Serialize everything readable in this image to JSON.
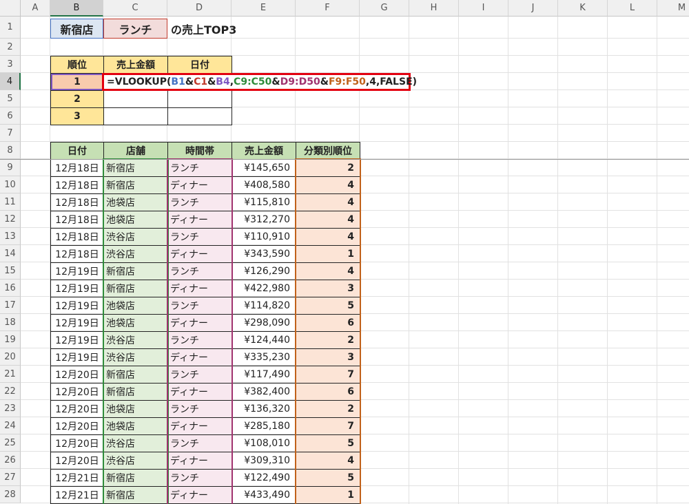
{
  "columns": [
    "A",
    "B",
    "C",
    "D",
    "E",
    "F",
    "G",
    "H",
    "I",
    "J",
    "K",
    "L",
    "M"
  ],
  "rows": [
    "1",
    "2",
    "3",
    "4",
    "5",
    "6",
    "7",
    "8",
    "9",
    "10",
    "11",
    "12",
    "13",
    "14",
    "15",
    "16",
    "17",
    "18",
    "19",
    "20",
    "21",
    "22",
    "23",
    "24",
    "25",
    "26",
    "27",
    "28"
  ],
  "title": {
    "store": "新宿店",
    "timeslot": "ランチ",
    "suffix": "の売上TOP3"
  },
  "top3": {
    "headers": [
      "順位",
      "売上金額",
      "日付"
    ],
    "ranks": [
      "1",
      "2",
      "3"
    ]
  },
  "formula": [
    {
      "t": "=VLOOKUP(",
      "c": "#222222"
    },
    {
      "t": "B1",
      "c": "#4472c4"
    },
    {
      "t": "&",
      "c": "#222222"
    },
    {
      "t": "C1",
      "c": "#c0392b"
    },
    {
      "t": "&",
      "c": "#222222"
    },
    {
      "t": "B4",
      "c": "#7e57c2"
    },
    {
      "t": ",",
      "c": "#222222"
    },
    {
      "t": "C9:C50",
      "c": "#2e8b3a"
    },
    {
      "t": "&",
      "c": "#222222"
    },
    {
      "t": "D9:D50",
      "c": "#a0336f"
    },
    {
      "t": "&",
      "c": "#222222"
    },
    {
      "t": "F9:F50",
      "c": "#c0611a"
    },
    {
      "t": ",4,FALSE)",
      "c": "#222222"
    }
  ],
  "sales": {
    "headers": [
      "日付",
      "店舗",
      "時間帯",
      "売上金額",
      "分類別順位"
    ],
    "rows": [
      [
        "12月18日",
        "新宿店",
        "ランチ",
        "¥145,650",
        "2"
      ],
      [
        "12月18日",
        "新宿店",
        "ディナー",
        "¥408,580",
        "4"
      ],
      [
        "12月18日",
        "池袋店",
        "ランチ",
        "¥115,810",
        "4"
      ],
      [
        "12月18日",
        "池袋店",
        "ディナー",
        "¥312,270",
        "4"
      ],
      [
        "12月18日",
        "渋谷店",
        "ランチ",
        "¥110,910",
        "4"
      ],
      [
        "12月18日",
        "渋谷店",
        "ディナー",
        "¥343,590",
        "1"
      ],
      [
        "12月19日",
        "新宿店",
        "ランチ",
        "¥126,290",
        "4"
      ],
      [
        "12月19日",
        "新宿店",
        "ディナー",
        "¥422,980",
        "3"
      ],
      [
        "12月19日",
        "池袋店",
        "ランチ",
        "¥114,820",
        "5"
      ],
      [
        "12月19日",
        "池袋店",
        "ディナー",
        "¥298,090",
        "6"
      ],
      [
        "12月19日",
        "渋谷店",
        "ランチ",
        "¥124,440",
        "2"
      ],
      [
        "12月19日",
        "渋谷店",
        "ディナー",
        "¥335,230",
        "3"
      ],
      [
        "12月20日",
        "新宿店",
        "ランチ",
        "¥117,490",
        "7"
      ],
      [
        "12月20日",
        "新宿店",
        "ディナー",
        "¥382,400",
        "6"
      ],
      [
        "12月20日",
        "池袋店",
        "ランチ",
        "¥136,320",
        "2"
      ],
      [
        "12月20日",
        "池袋店",
        "ディナー",
        "¥285,180",
        "7"
      ],
      [
        "12月20日",
        "渋谷店",
        "ランチ",
        "¥108,010",
        "5"
      ],
      [
        "12月20日",
        "渋谷店",
        "ディナー",
        "¥309,310",
        "4"
      ],
      [
        "12月21日",
        "新宿店",
        "ランチ",
        "¥122,490",
        "5"
      ],
      [
        "12月21日",
        "新宿店",
        "ディナー",
        "¥433,490",
        "1"
      ]
    ]
  },
  "colors": {
    "header_green": "#c6e0b4",
    "header_yellow": "#ffe699",
    "store_fill": "#e2efda",
    "timeslot_fill": "#f8e8ef",
    "rank_fill": "#fce4d6",
    "formula_border": "#e3000f"
  }
}
